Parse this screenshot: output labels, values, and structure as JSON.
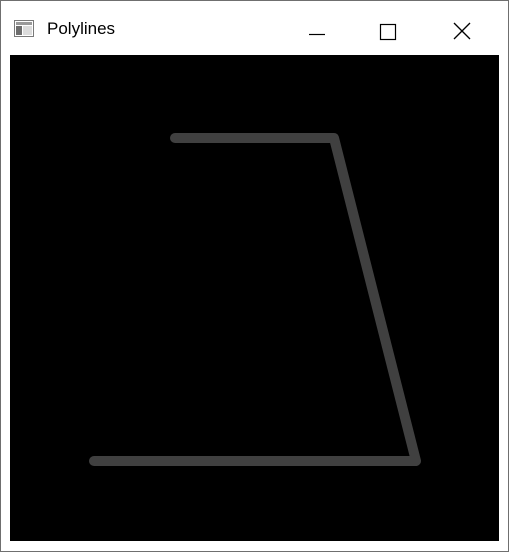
{
  "window": {
    "title": "Polylines",
    "icon": "app-window-icon",
    "controls": {
      "minimize_icon": "minimize-icon",
      "maximize_icon": "maximize-icon",
      "close_icon": "close-icon"
    }
  },
  "canvas": {
    "background": "#000000",
    "polyline_color": "#404040"
  }
}
